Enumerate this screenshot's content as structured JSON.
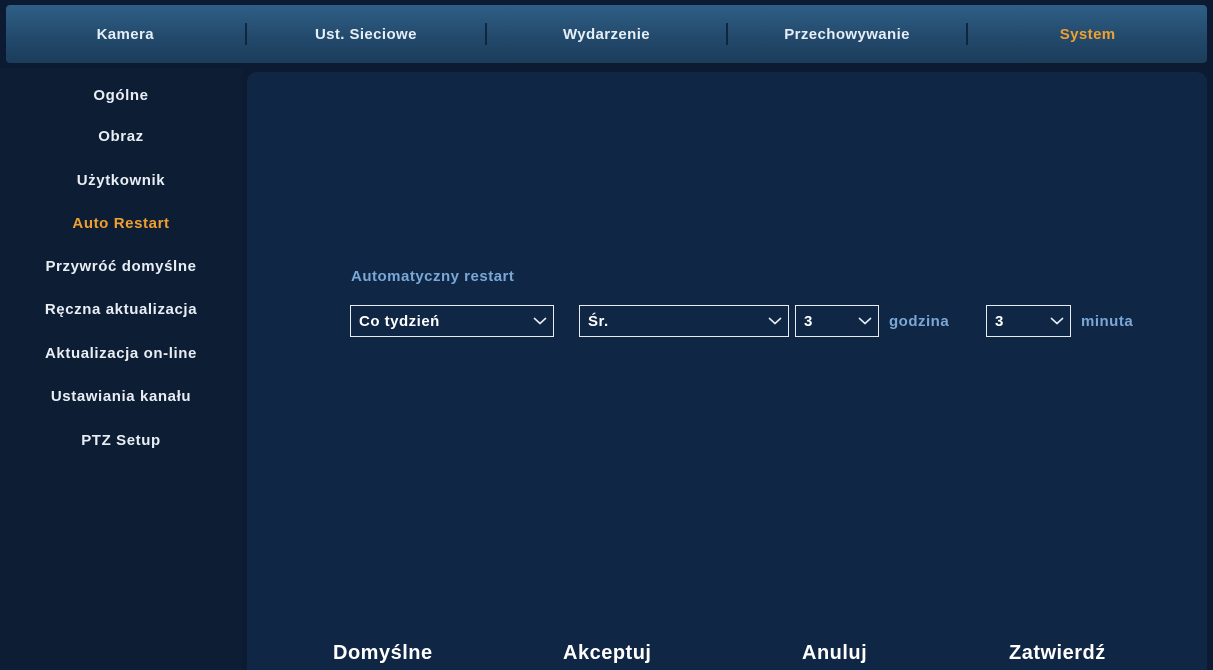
{
  "tabs": [
    {
      "label": "Kamera",
      "active": false
    },
    {
      "label": "Ust. Sieciowe",
      "active": false
    },
    {
      "label": "Wydarzenie",
      "active": false
    },
    {
      "label": "Przechowywanie",
      "active": false
    },
    {
      "label": "System",
      "active": true
    }
  ],
  "sidebar": {
    "items": [
      {
        "label": "Ogólne",
        "active": false
      },
      {
        "label": "Obraz",
        "active": false
      },
      {
        "label": "Użytkownik",
        "active": false
      },
      {
        "label": "Auto Restart",
        "active": true
      },
      {
        "label": "Przywróć domyślne",
        "active": false
      },
      {
        "label": "Ręczna aktualizacja",
        "active": false
      },
      {
        "label": "Aktualizacja on-line",
        "active": false
      },
      {
        "label": "Ustawiania kanału",
        "active": false
      },
      {
        "label": "PTZ Setup",
        "active": false
      }
    ]
  },
  "restart": {
    "title": "Automatyczny restart",
    "frequency": "Co tydzień",
    "day": "Śr.",
    "hour": "3",
    "hour_unit": "godzina",
    "minute": "3",
    "minute_unit": "minuta"
  },
  "buttons": {
    "default": "Domyślne",
    "accept": "Akceptuj",
    "cancel": "Anuluj",
    "confirm": "Zatwierdź"
  },
  "colors": {
    "accent": "#f0a030",
    "label_blue": "#7aa7d6",
    "panel": "#0f2644",
    "background": "#0c1b31"
  }
}
